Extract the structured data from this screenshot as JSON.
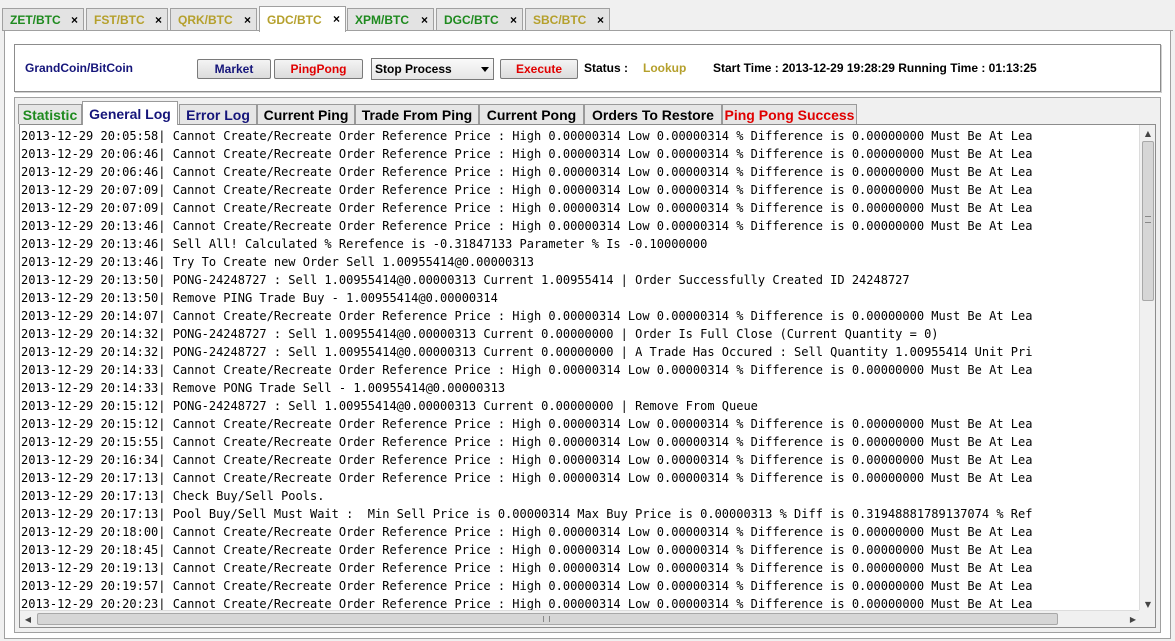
{
  "top_tabs": [
    {
      "label": "ZET/BTC",
      "color": "#1e8a1e"
    },
    {
      "label": "FST/BTC",
      "color": "#b5a02c"
    },
    {
      "label": "QRK/BTC",
      "color": "#b5a02c"
    },
    {
      "label": "GDC/BTC",
      "color": "#b5a02c",
      "active": true
    },
    {
      "label": "XPM/BTC",
      "color": "#1e8a1e"
    },
    {
      "label": "DGC/BTC",
      "color": "#1e8a1e"
    },
    {
      "label": "SBC/BTC",
      "color": "#b5a02c"
    }
  ],
  "close_glyph": "×",
  "header": {
    "pair_name": "GrandCoin/BitCoin",
    "market_label": "Market",
    "pingpong_label": "PingPong",
    "process_select": "Stop Process",
    "execute_label": "Execute",
    "status_label": "Status :",
    "status_value": "Lookup",
    "start_time": "Start Time : 2013-12-29 19:28:29  Running Time : 01:13:25"
  },
  "inner_tabs": [
    {
      "label": "Statistic",
      "color": "#1e8a1e"
    },
    {
      "label": "General Log",
      "color": "#15157a",
      "active": true
    },
    {
      "label": "Error Log",
      "color": "#15157a"
    },
    {
      "label": "Current Ping",
      "color": "#000000"
    },
    {
      "label": "Trade From Ping",
      "color": "#000000"
    },
    {
      "label": "Current Pong",
      "color": "#000000"
    },
    {
      "label": "Orders To Restore",
      "color": "#000000"
    },
    {
      "label": "Ping Pong Success",
      "color": "#e00000"
    }
  ],
  "log_lines": [
    "2013-12-29 20:05:58| Cannot Create/Recreate Order Reference Price : High 0.00000314 Low 0.00000314 % Difference is 0.00000000 Must Be At Lea",
    "2013-12-29 20:06:46| Cannot Create/Recreate Order Reference Price : High 0.00000314 Low 0.00000314 % Difference is 0.00000000 Must Be At Lea",
    "2013-12-29 20:06:46| Cannot Create/Recreate Order Reference Price : High 0.00000314 Low 0.00000314 % Difference is 0.00000000 Must Be At Lea",
    "2013-12-29 20:07:09| Cannot Create/Recreate Order Reference Price : High 0.00000314 Low 0.00000314 % Difference is 0.00000000 Must Be At Lea",
    "2013-12-29 20:07:09| Cannot Create/Recreate Order Reference Price : High 0.00000314 Low 0.00000314 % Difference is 0.00000000 Must Be At Lea",
    "2013-12-29 20:13:46| Cannot Create/Recreate Order Reference Price : High 0.00000314 Low 0.00000314 % Difference is 0.00000000 Must Be At Lea",
    "2013-12-29 20:13:46| Sell All! Calculated % Rerefence is -0.31847133 Parameter % Is -0.10000000",
    "2013-12-29 20:13:46| Try To Create new Order Sell 1.00955414@0.00000313",
    "2013-12-29 20:13:50| PONG-24248727 : Sell 1.00955414@0.00000313 Current 1.00955414 | Order Successfully Created ID 24248727",
    "2013-12-29 20:13:50| Remove PING Trade Buy - 1.00955414@0.00000314",
    "2013-12-29 20:14:07| Cannot Create/Recreate Order Reference Price : High 0.00000314 Low 0.00000314 % Difference is 0.00000000 Must Be At Lea",
    "2013-12-29 20:14:32| PONG-24248727 : Sell 1.00955414@0.00000313 Current 0.00000000 | Order Is Full Close (Current Quantity = 0)",
    "2013-12-29 20:14:32| PONG-24248727 : Sell 1.00955414@0.00000313 Current 0.00000000 | A Trade Has Occured : Sell Quantity 1.00955414 Unit Pri",
    "2013-12-29 20:14:33| Cannot Create/Recreate Order Reference Price : High 0.00000314 Low 0.00000314 % Difference is 0.00000000 Must Be At Lea",
    "2013-12-29 20:14:33| Remove PONG Trade Sell - 1.00955414@0.00000313",
    "2013-12-29 20:15:12| PONG-24248727 : Sell 1.00955414@0.00000313 Current 0.00000000 | Remove From Queue",
    "2013-12-29 20:15:12| Cannot Create/Recreate Order Reference Price : High 0.00000314 Low 0.00000314 % Difference is 0.00000000 Must Be At Lea",
    "2013-12-29 20:15:55| Cannot Create/Recreate Order Reference Price : High 0.00000314 Low 0.00000314 % Difference is 0.00000000 Must Be At Lea",
    "2013-12-29 20:16:34| Cannot Create/Recreate Order Reference Price : High 0.00000314 Low 0.00000314 % Difference is 0.00000000 Must Be At Lea",
    "2013-12-29 20:17:13| Cannot Create/Recreate Order Reference Price : High 0.00000314 Low 0.00000314 % Difference is 0.00000000 Must Be At Lea",
    "2013-12-29 20:17:13| Check Buy/Sell Pools.",
    "2013-12-29 20:17:13| Pool Buy/Sell Must Wait :  Min Sell Price is 0.00000314 Max Buy Price is 0.00000313 % Diff is 0.31948881789137074 % Ref",
    "2013-12-29 20:18:00| Cannot Create/Recreate Order Reference Price : High 0.00000314 Low 0.00000314 % Difference is 0.00000000 Must Be At Lea",
    "2013-12-29 20:18:45| Cannot Create/Recreate Order Reference Price : High 0.00000314 Low 0.00000314 % Difference is 0.00000000 Must Be At Lea",
    "2013-12-29 20:19:13| Cannot Create/Recreate Order Reference Price : High 0.00000314 Low 0.00000314 % Difference is 0.00000000 Must Be At Lea",
    "2013-12-29 20:19:57| Cannot Create/Recreate Order Reference Price : High 0.00000314 Low 0.00000314 % Difference is 0.00000000 Must Be At Lea",
    "2013-12-29 20:20:23| Cannot Create/Recreate Order Reference Price : High 0.00000314 Low 0.00000314 % Difference is 0.00000000 Must Be At Lea"
  ],
  "scrollbar_glyphs": {
    "up": "▲",
    "down": "▼",
    "left": "◀",
    "right": "▶"
  }
}
